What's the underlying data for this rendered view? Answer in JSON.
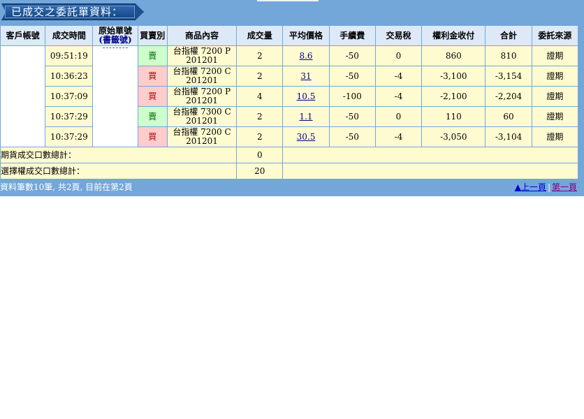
{
  "title": "已成交之委託單資料：",
  "headers": [
    "客戶帳號",
    "成交時間",
    "原始單號",
    "買賣別",
    "商品內容",
    "成交量",
    "平均價格",
    "手續費",
    "交易稅",
    "權利金收付",
    "合計",
    "委託來源"
  ],
  "orig_no_sub": "(書籤號)",
  "rows": [
    {
      "time": "09:51:19",
      "side": "賣",
      "product_line1": "台指權 7200 P",
      "product_line2": "201201",
      "qty": "2",
      "avg_price": "8.6",
      "fee": "-50",
      "tax": "0",
      "premium": "860",
      "total": "810",
      "source": "證期"
    },
    {
      "time": "10:36:23",
      "side": "買",
      "product_line1": "台指權 7200 C",
      "product_line2": "201201",
      "qty": "2",
      "avg_price": "31",
      "fee": "-50",
      "tax": "-4",
      "premium": "-3,100",
      "total": "-3,154",
      "source": "證期"
    },
    {
      "time": "10:37:09",
      "side": "買",
      "product_line1": "台指權 7200 P",
      "product_line2": "201201",
      "qty": "4",
      "avg_price": "10.5",
      "fee": "-100",
      "tax": "-4",
      "premium": "-2,100",
      "total": "-2,204",
      "source": "證期"
    },
    {
      "time": "10:37:29",
      "side": "賣",
      "product_line1": "台指權 7300 C",
      "product_line2": "201201",
      "qty": "2",
      "avg_price": "1.1",
      "fee": "-50",
      "tax": "0",
      "premium": "110",
      "total": "60",
      "source": "證期"
    },
    {
      "time": "10:37:29",
      "side": "買",
      "product_line1": "台指權 7200 C",
      "product_line2": "201201",
      "qty": "2",
      "avg_price": "30.5",
      "fee": "-50",
      "tax": "-4",
      "premium": "-3,050",
      "total": "-3,104",
      "source": "證期"
    }
  ],
  "summary": {
    "futures_label": "期貨成交口數總計：",
    "futures_value": "0",
    "options_label": "選擇權成交口數總計：",
    "options_value": "20"
  },
  "footer": {
    "info": "資料筆數10筆, 共2頁, 目前在第2頁",
    "prev": "▲上一頁",
    "sep": "|",
    "first": "第一頁"
  },
  "colors": {
    "panel": "#73a7da",
    "header_bg": "#dde9f6",
    "row_bg": "#fffbd0",
    "sell_bg": "#ccffcc",
    "buy_bg": "#ffcccc"
  }
}
